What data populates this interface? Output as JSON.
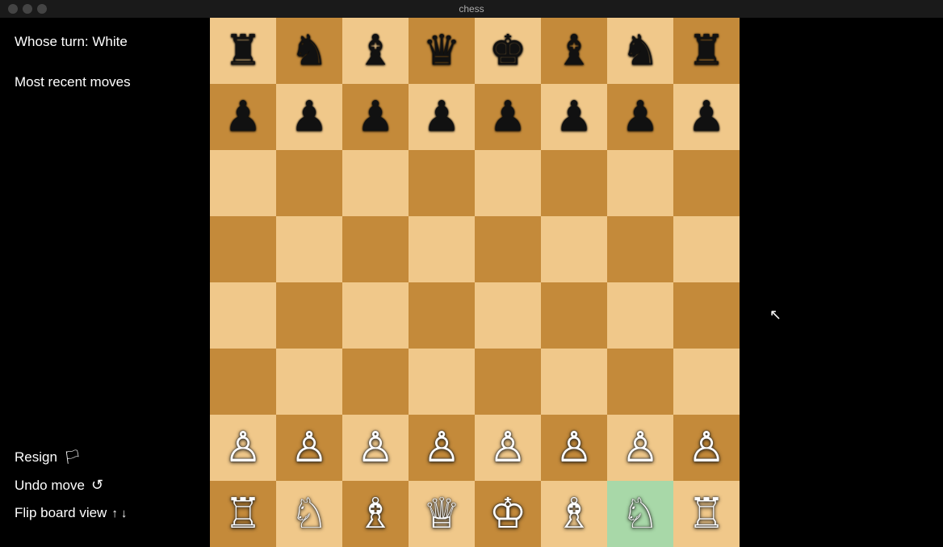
{
  "titlebar": {
    "title": "chess",
    "buttons": [
      "close",
      "minimize",
      "maximize"
    ]
  },
  "sidebar": {
    "whose_turn_label": "Whose turn: White",
    "most_recent_moves_label": "Most recent moves",
    "resign_label": "Resign",
    "undo_move_label": "Undo move",
    "flip_board_label": "Flip board view",
    "flip_up_label": "↑",
    "flip_down_label": "↓"
  },
  "board": {
    "colors": {
      "light": "#f0c88a",
      "dark": "#c48a3a",
      "highlight": "#a8d8a8"
    },
    "rows": [
      [
        "br",
        "bn",
        "bb",
        "bq",
        "bk",
        "bb",
        "bn",
        "br"
      ],
      [
        "bp",
        "bp",
        "bp",
        "bp",
        "bp",
        "bp",
        "bp",
        "bp"
      ],
      [
        "",
        "",
        "",
        "",
        "",
        "",
        "",
        ""
      ],
      [
        "",
        "",
        "",
        "",
        "",
        "",
        "",
        ""
      ],
      [
        "",
        "",
        "",
        "",
        "",
        "",
        "",
        ""
      ],
      [
        "",
        "",
        "",
        "",
        "",
        "",
        "",
        ""
      ],
      [
        "wp",
        "wp",
        "wp",
        "wp",
        "wp",
        "wp",
        "wp",
        "wp"
      ],
      [
        "wr",
        "wn",
        "wb",
        "wq",
        "wk",
        "wb",
        "wn_h",
        "wr"
      ]
    ],
    "highlight_cell": "g8"
  }
}
